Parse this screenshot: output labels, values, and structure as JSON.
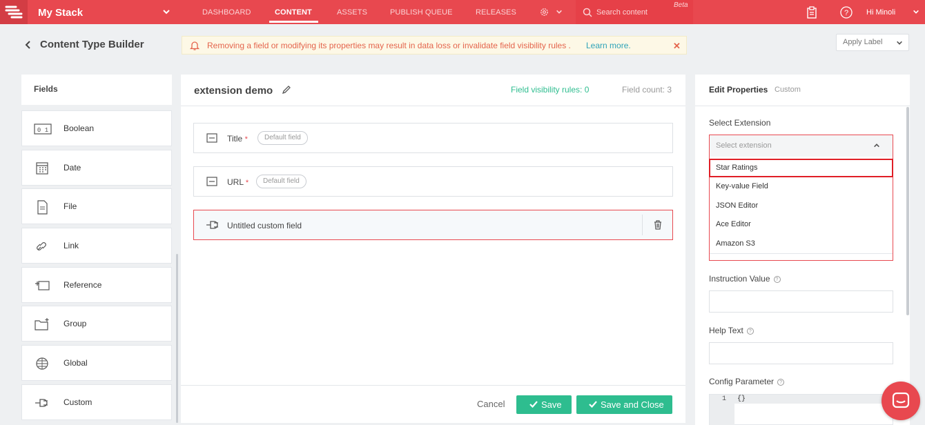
{
  "topbar": {
    "stack_name": "My Stack",
    "nav": [
      "DASHBOARD",
      "CONTENT",
      "ASSETS",
      "PUBLISH QUEUE",
      "RELEASES"
    ],
    "active_nav": "CONTENT",
    "search_placeholder": "Search content",
    "beta": "Beta",
    "greeting": "Hi  Minoli"
  },
  "header": {
    "title": "Content Type Builder",
    "warning_text": "Removing a field or modifying its properties may result in data loss or invalidate field visibility rules .",
    "warning_link": "Learn more.",
    "apply_label": "Apply Label"
  },
  "fields_panel": {
    "title": "Fields",
    "items": [
      {
        "label": "Boolean",
        "icon": "boolean-icon"
      },
      {
        "label": "Date",
        "icon": "calendar-icon"
      },
      {
        "label": "File",
        "icon": "file-icon"
      },
      {
        "label": "Link",
        "icon": "link-icon"
      },
      {
        "label": "Reference",
        "icon": "reference-icon"
      },
      {
        "label": "Group",
        "icon": "group-icon"
      },
      {
        "label": "Global",
        "icon": "global-icon"
      },
      {
        "label": "Custom",
        "icon": "plug-icon"
      }
    ]
  },
  "builder": {
    "content_type_name": "extension demo",
    "visibility_rules": "Field visibility rules: 0",
    "field_count": "Field count: 3",
    "rows": [
      {
        "label": "Title",
        "required": "*",
        "badge": "Default field"
      },
      {
        "label": "URL",
        "required": "*",
        "badge": "Default field"
      },
      {
        "label": "Untitled custom field",
        "required": "",
        "badge": ""
      }
    ],
    "cancel": "Cancel",
    "save": "Save",
    "save_close": "Save and Close"
  },
  "properties": {
    "title": "Edit Properties",
    "subtitle": "Custom",
    "select_label": "Select Extension",
    "select_placeholder": "Select extension",
    "options": [
      "Star Ratings",
      "Key-value Field",
      "JSON Editor",
      "Ace Editor",
      "Amazon S3"
    ],
    "highlighted_option": "Star Ratings",
    "instruction_label": "Instruction Value",
    "help_label": "Help Text",
    "config_label": "Config Parameter",
    "code_line_number": "1",
    "code_text": "{}"
  },
  "colors": {
    "brand": "#e8484f",
    "success": "#2ebd8f",
    "link": "#2ea3b8",
    "warning_text": "#e4644c"
  }
}
